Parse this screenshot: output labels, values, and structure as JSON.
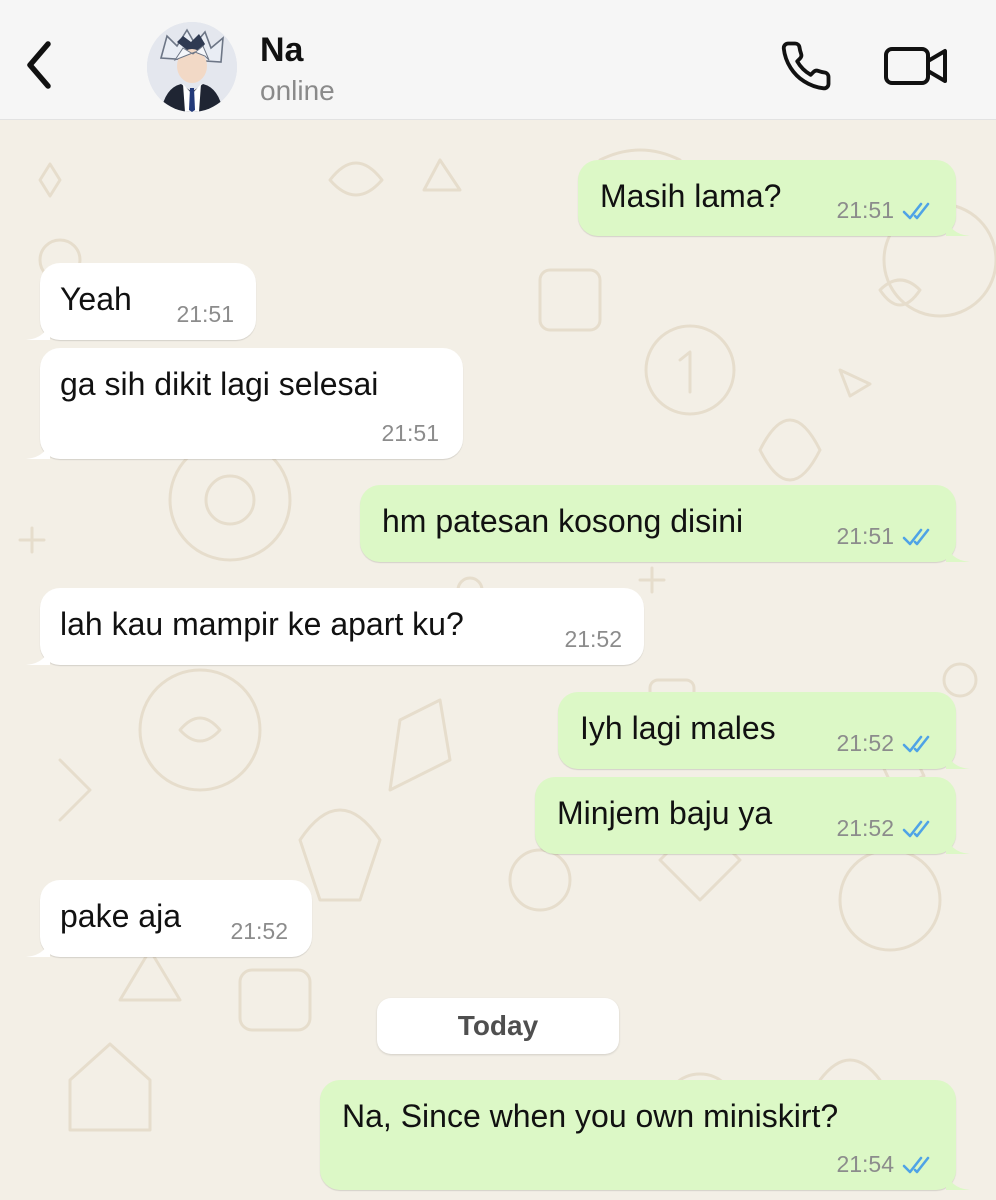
{
  "header": {
    "back_icon": "chevron-left-icon",
    "contact_name": "Na",
    "status": "online",
    "call_icon": "phone-icon",
    "video_icon": "video-camera-icon"
  },
  "colors": {
    "header_bg": "#f6f6f6",
    "wallpaper_bg": "#f3efe6",
    "incoming_bubble": "#ffffff",
    "outgoing_bubble": "#dcf8c6",
    "read_ticks": "#4fa3e6"
  },
  "messages": [
    {
      "direction": "outgoing",
      "text": "Masih lama?",
      "time": "21:51",
      "status": "read"
    },
    {
      "direction": "incoming",
      "text": "Yeah",
      "time": "21:51"
    },
    {
      "direction": "incoming",
      "text": "ga sih dikit lagi selesai",
      "time": "21:51"
    },
    {
      "direction": "outgoing",
      "text": "hm patesan kosong disini",
      "time": "21:51",
      "status": "read"
    },
    {
      "direction": "incoming",
      "text": "lah kau mampir ke apart ku?",
      "time": "21:52"
    },
    {
      "direction": "outgoing",
      "text": "Iyh lagi males",
      "time": "21:52",
      "status": "read"
    },
    {
      "direction": "outgoing",
      "text": "Minjem baju ya",
      "time": "21:52",
      "status": "read"
    },
    {
      "direction": "incoming",
      "text": "pake aja",
      "time": "21:52"
    },
    {
      "direction": "outgoing",
      "text": "Na, Since when you own miniskirt?",
      "time": "21:54",
      "status": "read"
    }
  ],
  "date_separator": "Today"
}
